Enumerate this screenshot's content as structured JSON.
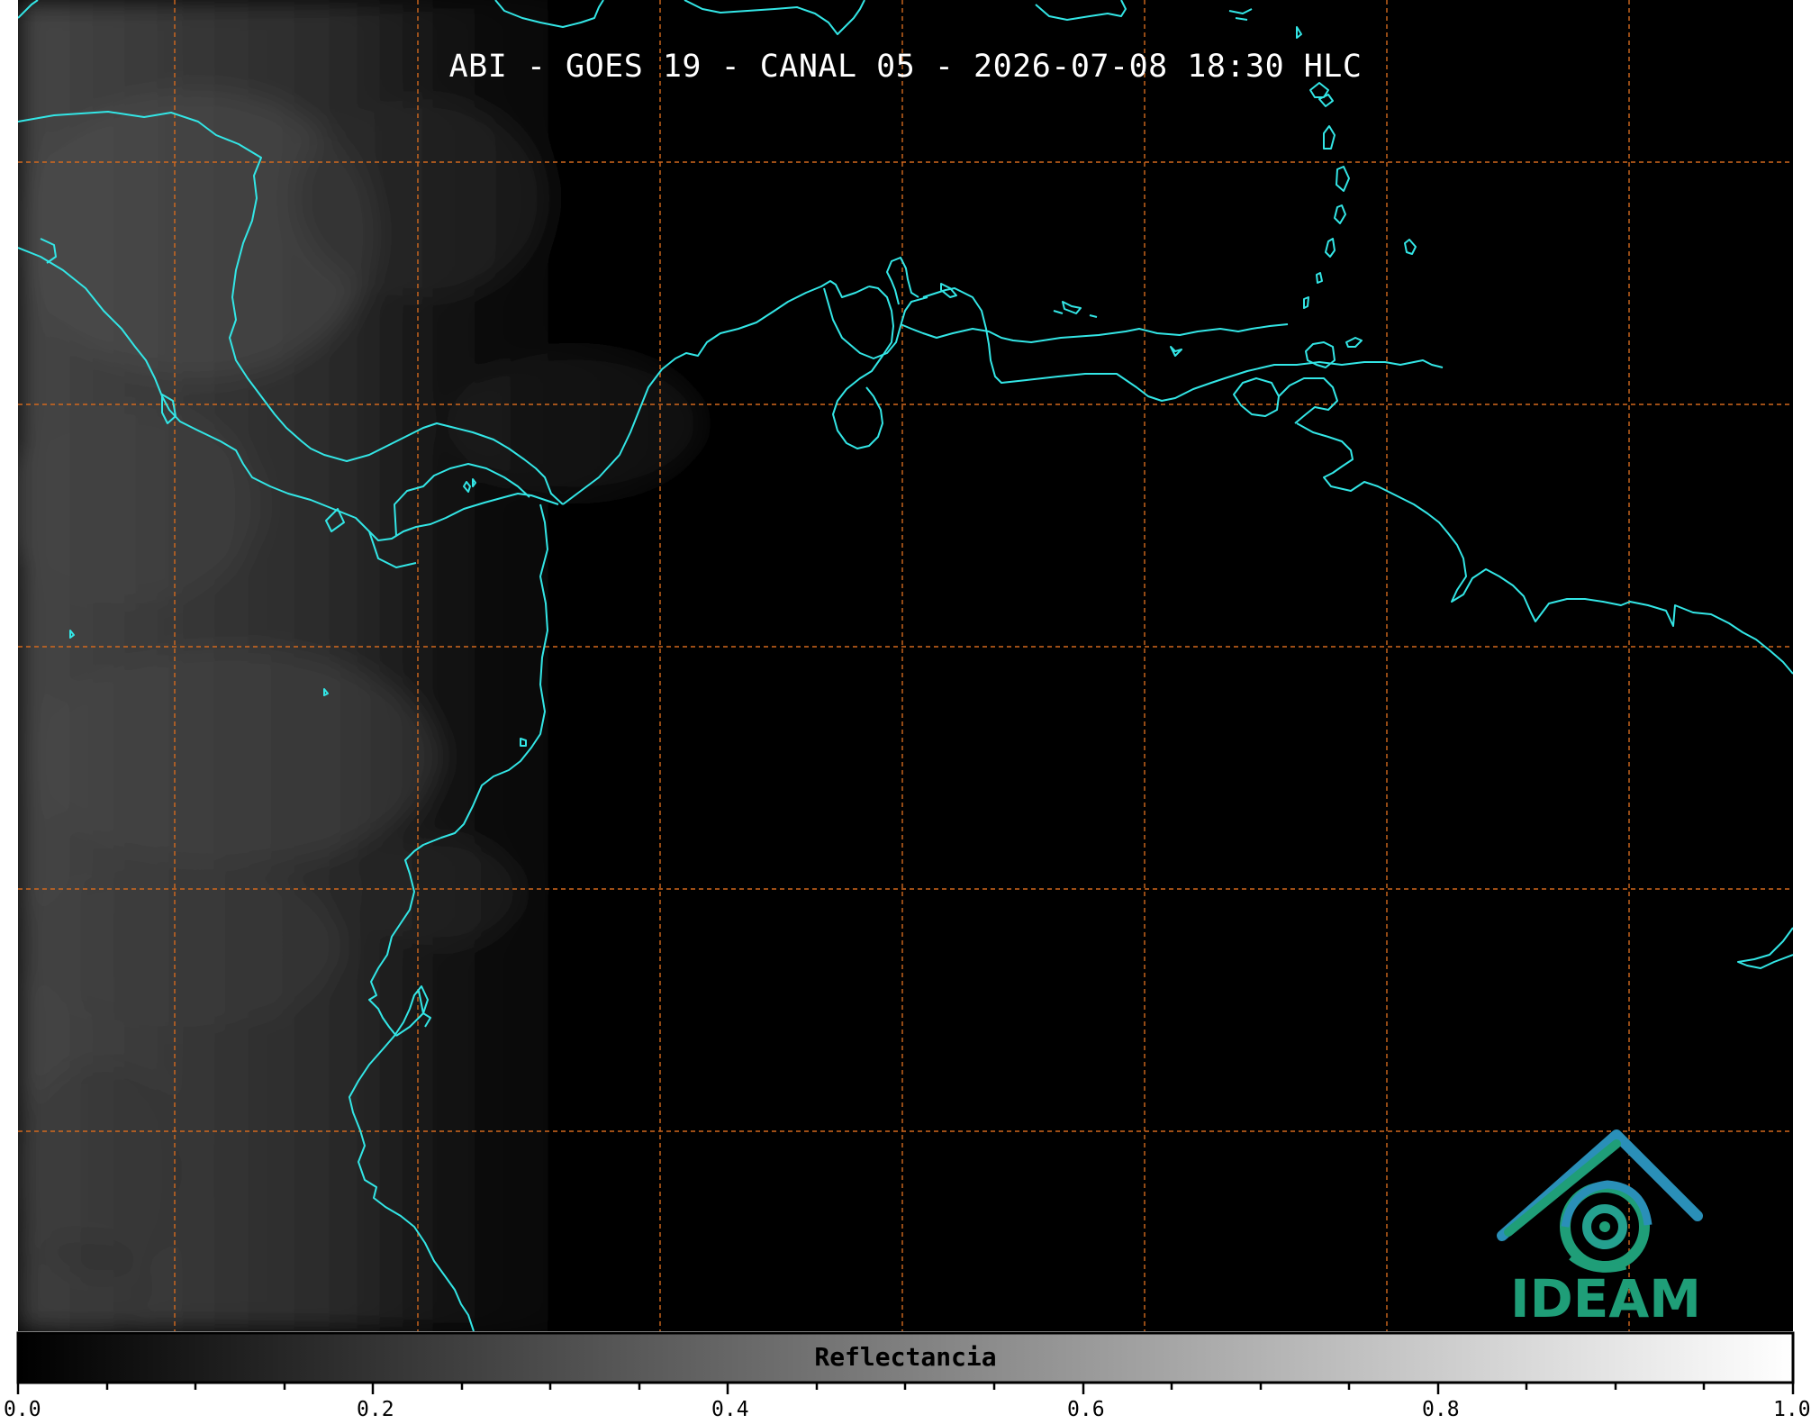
{
  "map": {
    "title": "ABI - GOES 19 - CANAL 05 - 2026-07-08 18:30 HLC",
    "background_color": "#000000",
    "coastline_color": "#33e6e6",
    "gridline_color": "#d2691e",
    "cloud_tint": "#5a5a5a"
  },
  "colorbar": {
    "label": "Reflectancia",
    "range": [
      0.0,
      1.0
    ],
    "colormap": "grayscale black-to-white",
    "tick_labels": [
      "0.0",
      "0.2",
      "0.4",
      "0.6",
      "0.8",
      "1.0"
    ]
  },
  "logo": {
    "text": "IDEAM",
    "icon": "ideam-mountain-swirl-logo",
    "text_color": "#1f9e78"
  }
}
